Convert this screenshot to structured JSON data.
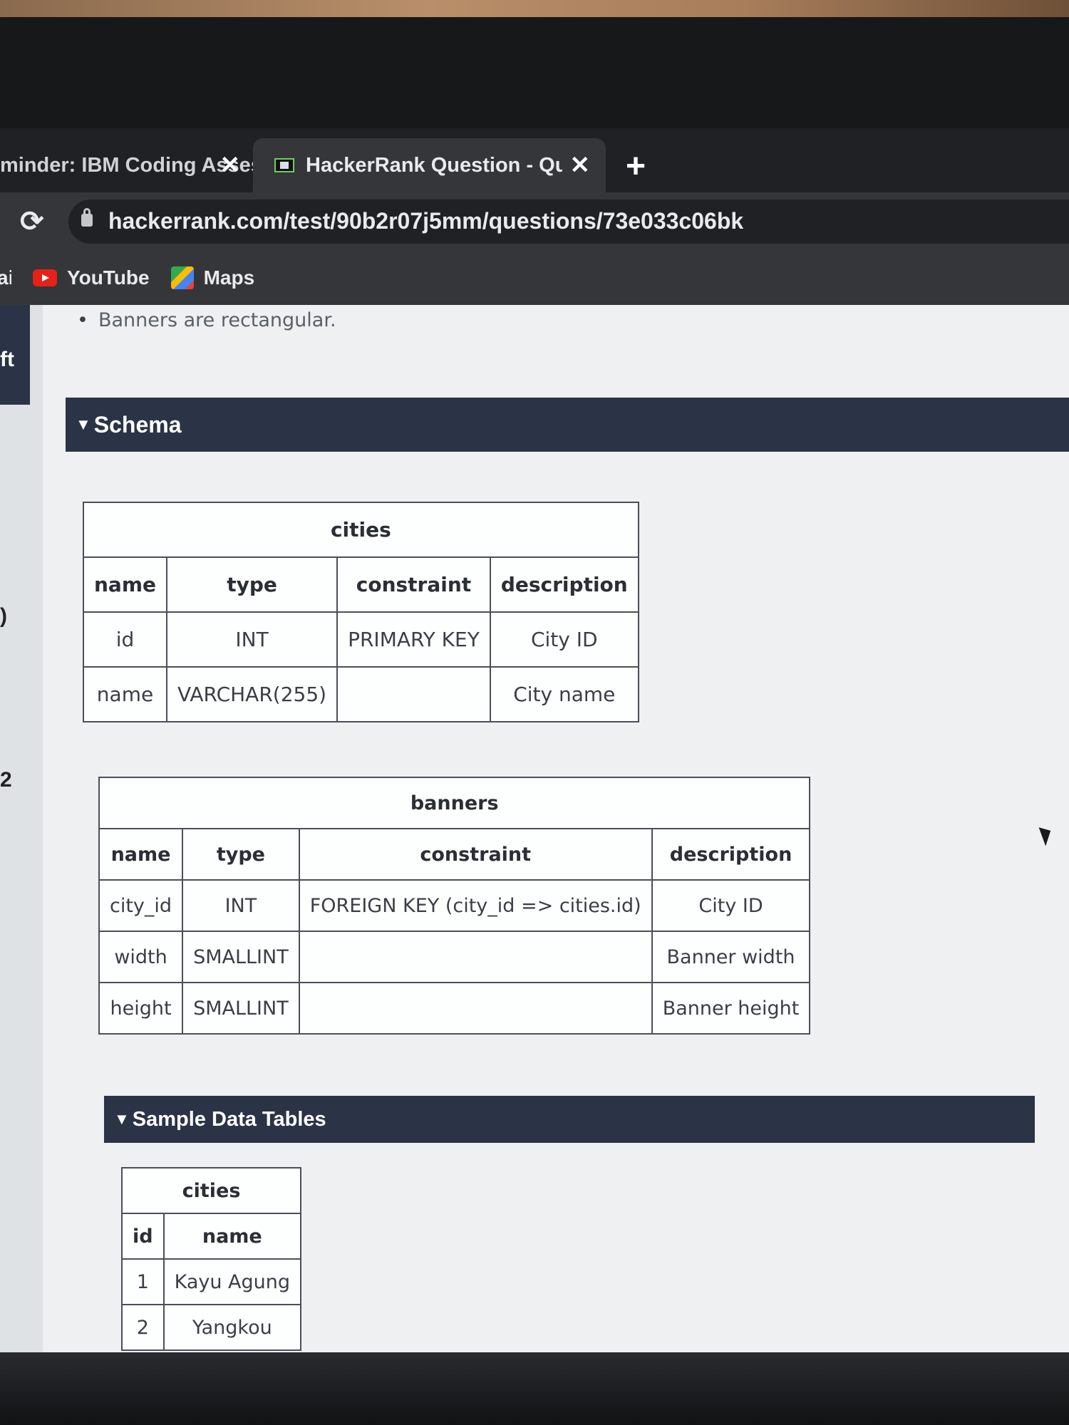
{
  "browser": {
    "tabs": [
      {
        "title": "minder: IBM Coding Assess",
        "active": false
      },
      {
        "title": "HackerRank Question - Questi",
        "active": true
      }
    ],
    "close_glyph": "✕",
    "new_tab_glyph": "+",
    "reload_glyph": "⟳",
    "url": "hackerrank.com/test/90b2r07j5mm/questions/73e033c06bk",
    "bookmarks": [
      {
        "label": "ail",
        "icon": ""
      },
      {
        "label": "YouTube",
        "icon": "youtube-icon"
      },
      {
        "label": "Maps",
        "icon": "maps-icon"
      }
    ]
  },
  "sidebar": {
    "fragments": [
      "ft",
      ")",
      "2"
    ]
  },
  "content": {
    "bullet": "Banners are rectangular.",
    "schema_heading": "Schema",
    "sample_heading": "Sample Data Tables",
    "caret": "▼",
    "cities_schema": {
      "table_name": "cities",
      "headers": [
        "name",
        "type",
        "constraint",
        "description"
      ],
      "rows": [
        [
          "id",
          "INT",
          "PRIMARY KEY",
          "City ID"
        ],
        [
          "name",
          "VARCHAR(255)",
          "",
          "City name"
        ]
      ]
    },
    "banners_schema": {
      "table_name": "banners",
      "headers": [
        "name",
        "type",
        "constraint",
        "description"
      ],
      "rows": [
        [
          "city_id",
          "INT",
          "FOREIGN KEY (city_id => cities.id)",
          "City ID"
        ],
        [
          "width",
          "SMALLINT",
          "",
          "Banner width"
        ],
        [
          "height",
          "SMALLINT",
          "",
          "Banner height"
        ]
      ]
    },
    "cities_sample": {
      "table_name": "cities",
      "headers": [
        "id",
        "name"
      ],
      "rows": [
        [
          "1",
          "Kayu Agung"
        ],
        [
          "2",
          "Yangkou"
        ]
      ]
    }
  }
}
